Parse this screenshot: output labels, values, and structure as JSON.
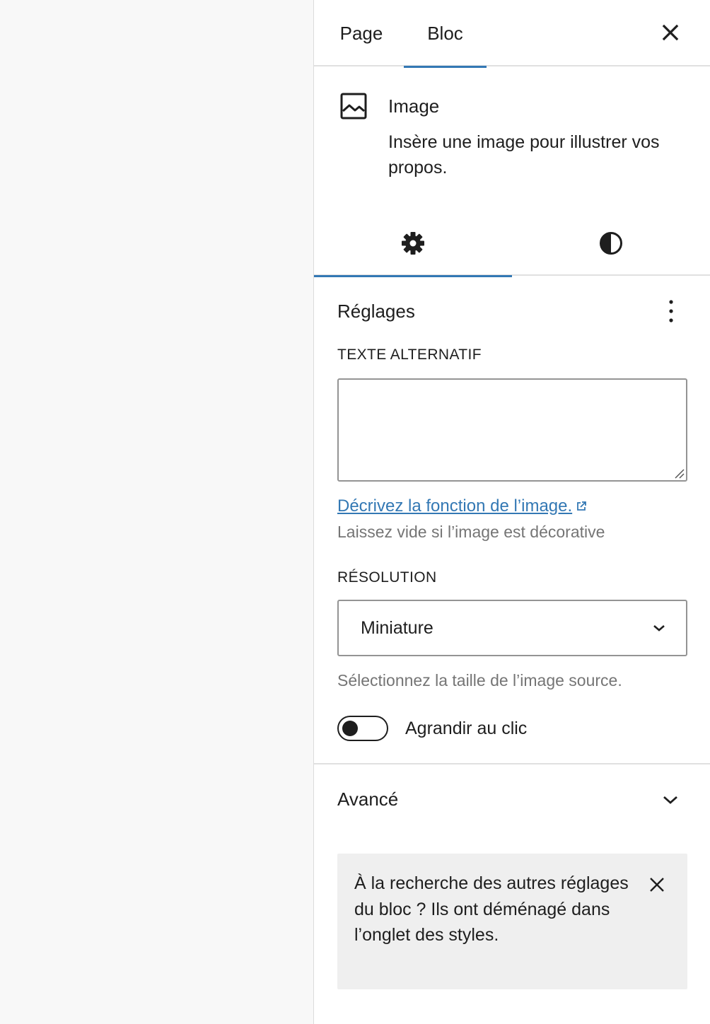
{
  "header": {
    "tabs": [
      {
        "label": "Page",
        "active": false
      },
      {
        "label": "Bloc",
        "active": true
      }
    ],
    "close_icon": "close-icon"
  },
  "block_card": {
    "icon": "image-icon",
    "title": "Image",
    "description": "Insère une image pour illustrer vos propos."
  },
  "inner_tabs": [
    {
      "icon": "gear-icon",
      "name": "settings",
      "active": true
    },
    {
      "icon": "contrast-icon",
      "name": "styles",
      "active": false
    }
  ],
  "settings": {
    "title": "Réglages",
    "more_icon": "more-vertical-icon",
    "alt_text": {
      "label": "TEXTE ALTERNATIF",
      "value": "",
      "link_text": "Décrivez la fonction de l’image.",
      "help": "Laissez vide si l’image est décorative"
    },
    "resolution": {
      "label": "RÉSOLUTION",
      "selected": "Miniature",
      "help": "Sélectionnez la taille de l’image source."
    },
    "lightbox": {
      "label": "Agrandir au clic",
      "enabled": false
    }
  },
  "advanced": {
    "label": "Avancé",
    "expanded": false
  },
  "notice": {
    "text": "À la recherche des autres réglages du bloc ? Ils ont déménagé dans l’onglet des styles."
  },
  "colors": {
    "accent": "#3378b4",
    "text": "#1e1e1e",
    "muted": "#757575",
    "border": "#949494",
    "notice_bg": "#efefef"
  }
}
